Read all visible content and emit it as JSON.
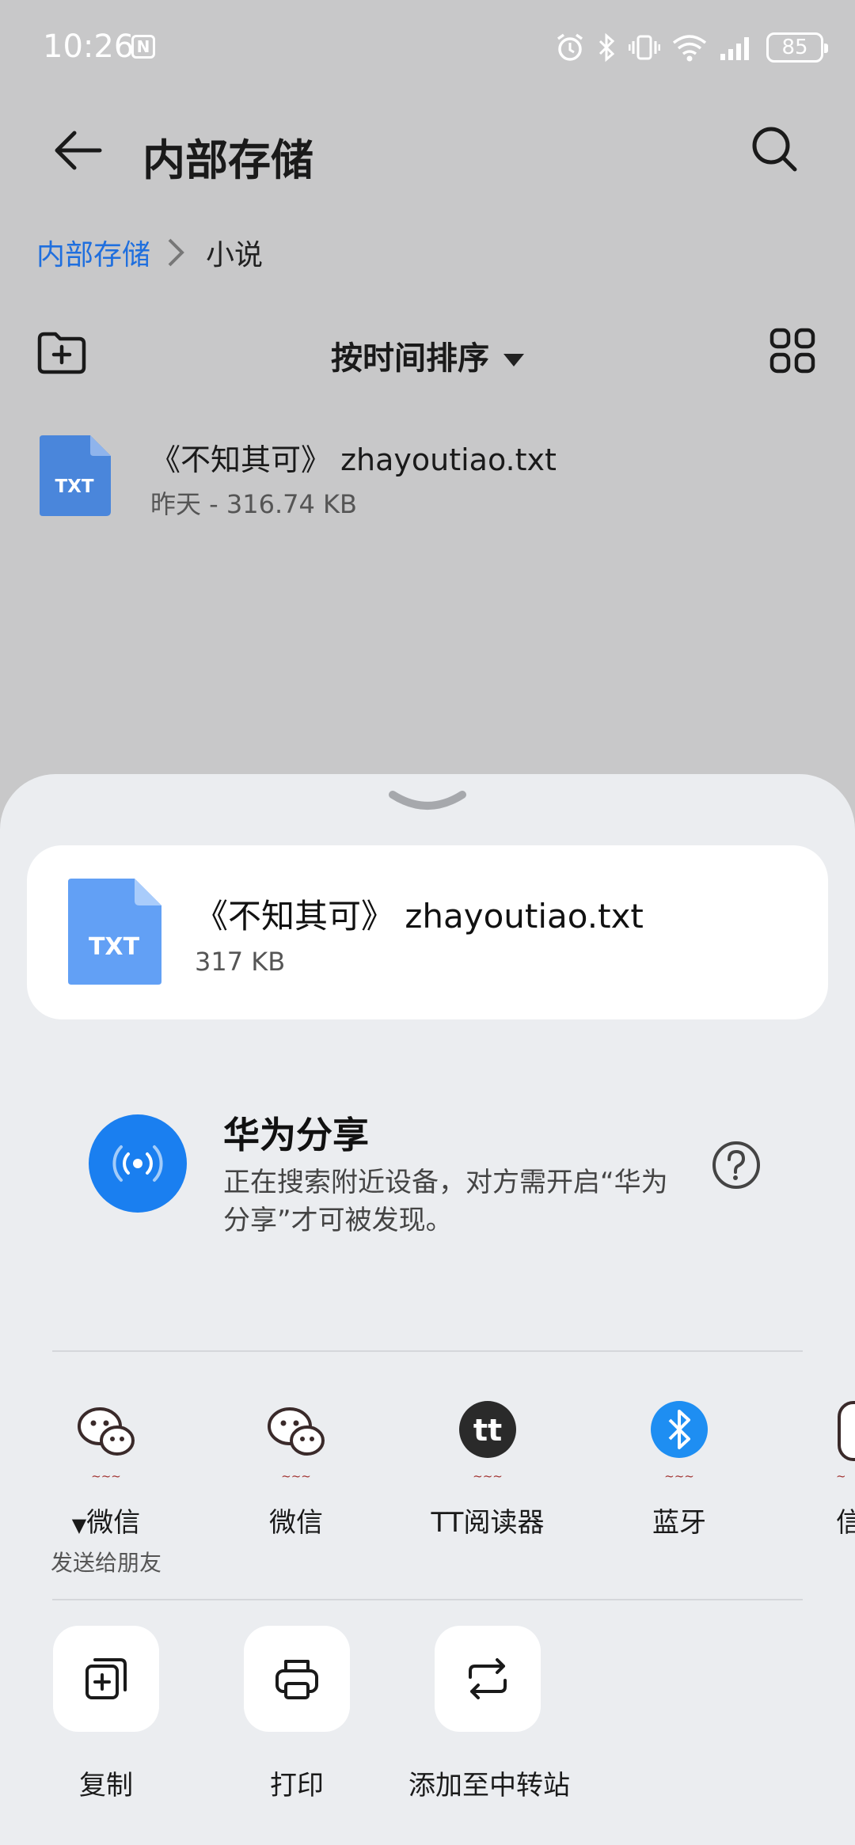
{
  "status_bar": {
    "time": "10:26",
    "nfc_label": "N",
    "battery": "85"
  },
  "header": {
    "title": "内部存储"
  },
  "breadcrumb": {
    "root": "内部存储",
    "current": "小说"
  },
  "toolbar": {
    "sort_label": "按时间排序"
  },
  "file_list": [
    {
      "thumb_label": "TXT",
      "name": "《不知其可》 zhayoutiao.txt",
      "meta": "昨天 - 316.74 KB"
    }
  ],
  "share_sheet": {
    "file": {
      "thumb_label": "TXT",
      "name": "《不知其可》 zhayoutiao.txt",
      "size": "317 KB"
    },
    "huawei_share": {
      "title": "华为分享",
      "description": "正在搜索附近设备，对方需开启“华为分享”才可被发现。"
    },
    "apps": [
      {
        "label": "微信",
        "pin": "▼",
        "sublabel": "发送给朋友",
        "icon": "wechat-icon"
      },
      {
        "label": "微信",
        "icon": "wechat-icon"
      },
      {
        "label": "TT阅读器",
        "icon": "tt-reader-icon"
      },
      {
        "label": "蓝牙",
        "icon": "bluetooth-icon"
      },
      {
        "label": "信",
        "icon": "partial-app-icon"
      }
    ],
    "actions": [
      {
        "label": "复制",
        "icon": "copy-icon"
      },
      {
        "label": "打印",
        "icon": "print-icon"
      },
      {
        "label": "添加至中转站",
        "icon": "transfer-station-icon"
      }
    ]
  },
  "colors": {
    "accent": "#1f6fde",
    "file_icon": "#4a86db",
    "share_blue": "#1a7ff0"
  }
}
